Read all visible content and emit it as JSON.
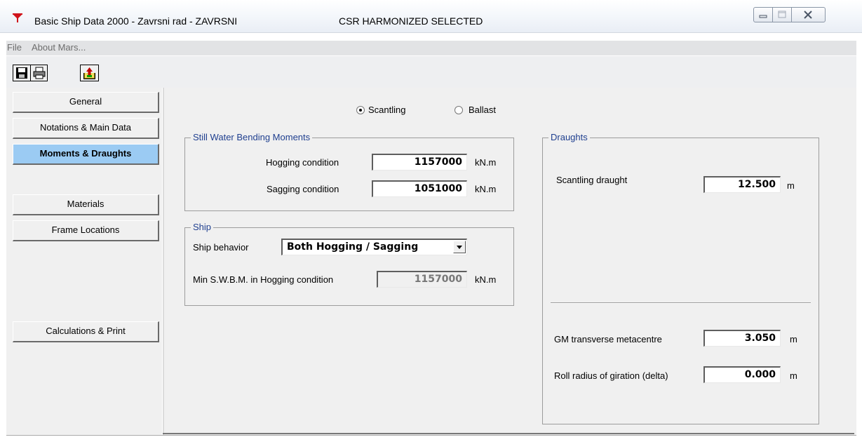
{
  "window": {
    "title": "Basic Ship Data 2000 - Zavrsni rad - ZAVRSNI",
    "title_extra": "CSR HARMONIZED SELECTED",
    "controls": [
      "minimize",
      "maximize",
      "close"
    ]
  },
  "menu": {
    "items": [
      "File",
      "About Mars..."
    ]
  },
  "toolbar": {
    "icons": [
      "save-icon",
      "print-icon",
      "export-icon"
    ]
  },
  "sidebar": {
    "items": [
      {
        "label": "General",
        "active": false
      },
      {
        "label": "Notations & Main Data",
        "active": false
      },
      {
        "label": "Moments & Draughts",
        "active": true
      },
      {
        "label": "Materials",
        "active": false
      },
      {
        "label": "Frame Locations",
        "active": false
      },
      {
        "label": "Calculations & Print",
        "active": false
      }
    ]
  },
  "mode": {
    "scantling_label": "Scantling",
    "ballast_label": "Ballast",
    "selected": "Scantling"
  },
  "swbm": {
    "group_title": "Still Water Bending Moments",
    "hogging_label": "Hogging condition",
    "hogging_value": "1157000",
    "hogging_unit": "kN.m",
    "sagging_label": "Sagging  condition",
    "sagging_value": "1051000",
    "sagging_unit": "kN.m"
  },
  "ship": {
    "group_title": "Ship",
    "behavior_label": "Ship behavior",
    "behavior_value": "Both Hogging / Sagging",
    "min_swbm_label": "Min S.W.B.M. in Hogging condition",
    "min_swbm_value": "1157000",
    "min_swbm_unit": "kN.m"
  },
  "draughts": {
    "group_title": "Draughts",
    "scantling_draught_label": "Scantling draught",
    "scantling_draught_value": "12.500",
    "scantling_draught_unit": "m",
    "gm_label": "GM transverse metacentre",
    "gm_value": "3.050",
    "gm_unit": "m",
    "roll_label": "Roll radius of giration (delta)",
    "roll_value": "0.000",
    "roll_unit": "m"
  },
  "colors": {
    "active_nav": "#9bcbf3",
    "group_title": "#1f3f8f",
    "app_icon": "#d0141b"
  }
}
